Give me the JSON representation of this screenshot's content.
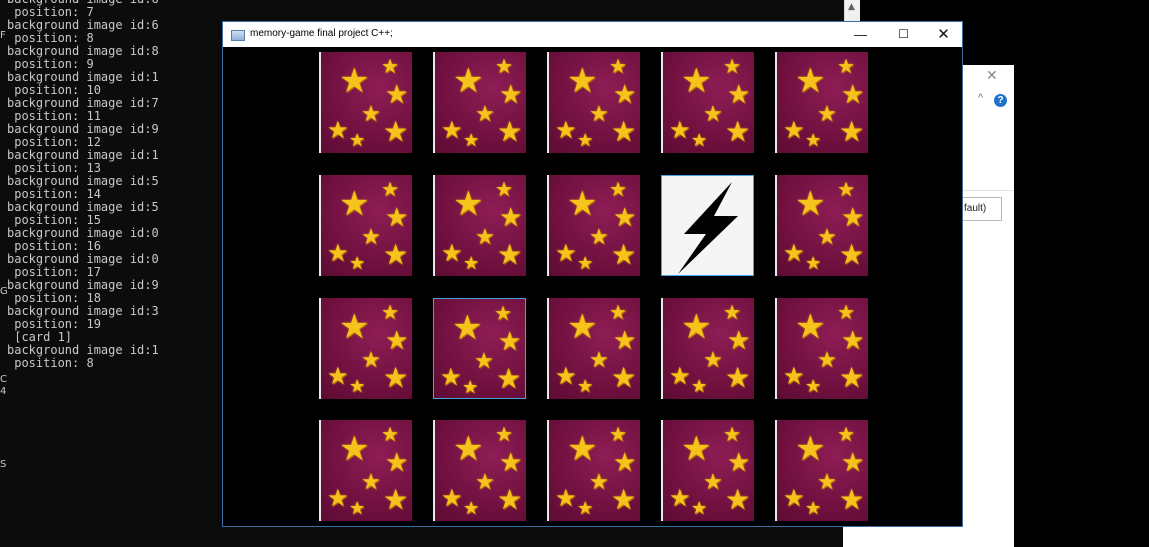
{
  "console": {
    "lines": [
      "background image id:6",
      " position: 7",
      "background image id:6",
      " position: 8",
      "background image id:8",
      " position: 9",
      "background image id:1",
      " position: 10",
      "background image id:7",
      " position: 11",
      "background image id:9",
      " position: 12",
      "background image id:1",
      " position: 13",
      "background image id:5",
      " position: 14",
      "background image id:5",
      " position: 15",
      "background image id:0",
      " position: 16",
      "background image id:0",
      " position: 17",
      "background image id:9",
      " position: 18",
      "background image id:3",
      " position: 19",
      " [card 1]",
      "background image id:1",
      " position: 8"
    ],
    "scroll_up": "▲"
  },
  "edge_letters": [
    "F",
    "G",
    "C",
    "4",
    "S"
  ],
  "dialog": {
    "close": "✕",
    "caret": "^",
    "help": "?",
    "field_text": "fault)"
  },
  "window": {
    "title": "memory-game final project C++;",
    "minimize": "—",
    "maximize": "☐",
    "close": "✕"
  },
  "board": {
    "rows": 4,
    "cols": 5,
    "flipped": {
      "row": 1,
      "col": 3,
      "image": "lightning-bolt"
    },
    "selected": {
      "row": 2,
      "col": 1
    },
    "card_back": "stars"
  }
}
